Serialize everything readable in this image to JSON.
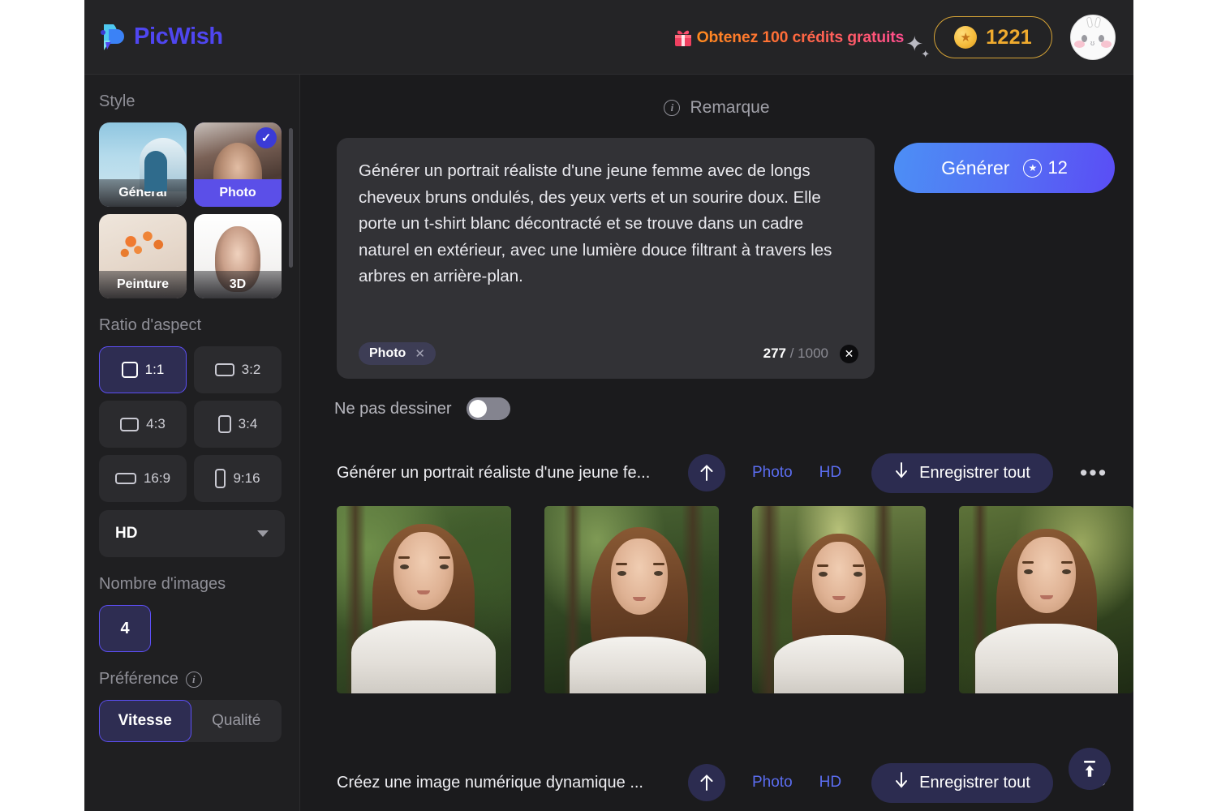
{
  "header": {
    "brand": "PicWish",
    "logo_icon": "picwish-logo-icon",
    "promo_text": "Obtenez 100 crédits gratuits",
    "gift_icon": "gift-icon",
    "credits_value": "1221",
    "coin_icon": "coin-star-icon",
    "avatar_icon": "user-avatar"
  },
  "sidebar": {
    "style_label": "Style",
    "styles": [
      {
        "label": "Général",
        "selected": false
      },
      {
        "label": "Photo",
        "selected": true
      },
      {
        "label": "Peinture",
        "selected": false
      },
      {
        "label": "3D",
        "selected": false
      }
    ],
    "ratio_label": "Ratio d'aspect",
    "ratios": [
      {
        "label": "1:1",
        "selected": true
      },
      {
        "label": "3:2",
        "selected": false
      },
      {
        "label": "4:3",
        "selected": false
      },
      {
        "label": "3:4",
        "selected": false
      },
      {
        "label": "16:9",
        "selected": false
      },
      {
        "label": "9:16",
        "selected": false
      }
    ],
    "quality_selected": "HD",
    "quality_caret_icon": "chevron-down-icon",
    "count_label": "Nombre d'images",
    "count_value": "4",
    "preference_label": "Préférence",
    "preference_info_icon": "info-icon",
    "preference_options": [
      {
        "label": "Vitesse",
        "selected": true
      },
      {
        "label": "Qualité",
        "selected": false
      }
    ]
  },
  "main": {
    "remarque_label": "Remarque",
    "remarque_info_icon": "info-icon",
    "prompt_text": "Générer un portrait réaliste d'une jeune femme avec de longs cheveux bruns ondulés, des yeux verts et un sourire doux. Elle porte un t-shirt blanc décontracté et se trouve dans un cadre naturel en extérieur, avec une lumière douce filtrant à travers les arbres en arrière-plan.",
    "prompt_tag": "Photo",
    "prompt_tag_remove_icon": "close-icon",
    "char_count": "277",
    "char_limit": "/ 1000",
    "clear_icon": "clear-circle-icon",
    "generate_label": "Générer",
    "generate_cost": "12",
    "generate_coin_icon": "star-coin-icon",
    "no_draw_label": "Ne pas dessiner",
    "no_draw_enabled": false,
    "results": [
      {
        "title": "Générer un portrait réaliste d'une jeune fe...",
        "upload_icon": "arrow-up-icon",
        "tag_style": "Photo",
        "tag_quality": "HD",
        "save_label": "Enregistrer tout",
        "save_icon": "download-icon",
        "more_icon": "more-horizontal-icon",
        "thumbs": [
          "bg-a",
          "bg-b",
          "bg-c",
          "bg-d"
        ]
      },
      {
        "title": "Créez une image numérique dynamique ...",
        "upload_icon": "arrow-up-icon",
        "tag_style": "Photo",
        "tag_quality": "HD",
        "save_label": "Enregistrer tout",
        "save_icon": "download-icon",
        "more_icon": "more-horizontal-icon",
        "thumbs": []
      }
    ],
    "fab_icon": "scroll-to-top-icon"
  },
  "colors": {
    "accent_blue": "#5d4ff6",
    "accent_indigo": "#3b3bd6",
    "credits_gold": "#f0ab2e",
    "promo_orange": "#ff8a1f",
    "promo_pink": "#ff4d8f",
    "panel_bg": "#1f1f21",
    "app_bg": "#1b1b1d"
  }
}
